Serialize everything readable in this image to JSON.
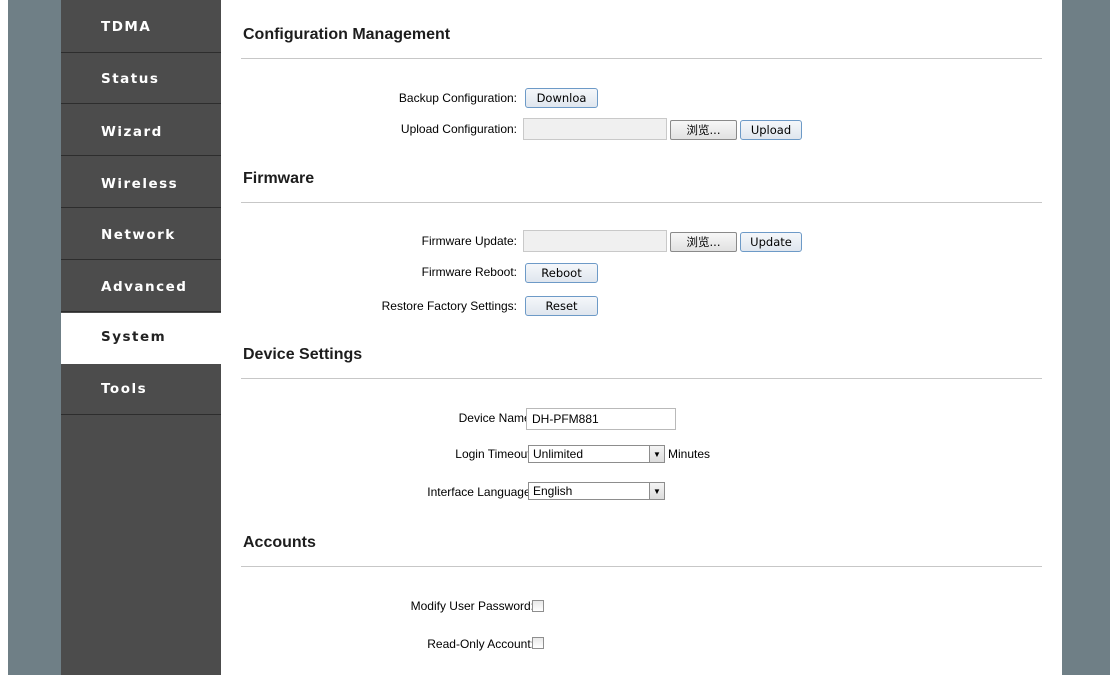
{
  "nav": {
    "items": [
      {
        "label": "TDMA"
      },
      {
        "label": "Status"
      },
      {
        "label": "Wizard"
      },
      {
        "label": "Wireless"
      },
      {
        "label": "Network"
      },
      {
        "label": "Advanced"
      },
      {
        "label": "System",
        "active": true
      },
      {
        "label": "Tools"
      }
    ]
  },
  "config": {
    "title": "Configuration Management",
    "backup_label": "Backup Configuration:",
    "backup_button": "Downloa",
    "upload_label": "Upload Configuration:",
    "browse_button": "浏览...",
    "upload_button": "Upload"
  },
  "firmware": {
    "title": "Firmware",
    "update_label": "Firmware Update:",
    "browse_button": "浏览...",
    "update_button": "Update",
    "reboot_label": "Firmware Reboot:",
    "reboot_button": "Reboot",
    "restore_label": "Restore Factory Settings:",
    "reset_button": "Reset"
  },
  "device": {
    "title": "Device Settings",
    "name_label": "Device Name:",
    "name_value": "DH-PFM881",
    "timeout_label": "Login Timeout:",
    "timeout_value": "Unlimited",
    "timeout_unit": "Minutes",
    "language_label": "Interface Language:",
    "language_value": "English"
  },
  "accounts": {
    "title": "Accounts",
    "modify_label": "Modify User Password:",
    "modify_checked": false,
    "readonly_label": "Read-Only Account:",
    "readonly_checked": false
  },
  "colors": {
    "sidebar": "#4c4c4c",
    "rail": "#6f7f86",
    "button_border": "#6d9ac7"
  }
}
